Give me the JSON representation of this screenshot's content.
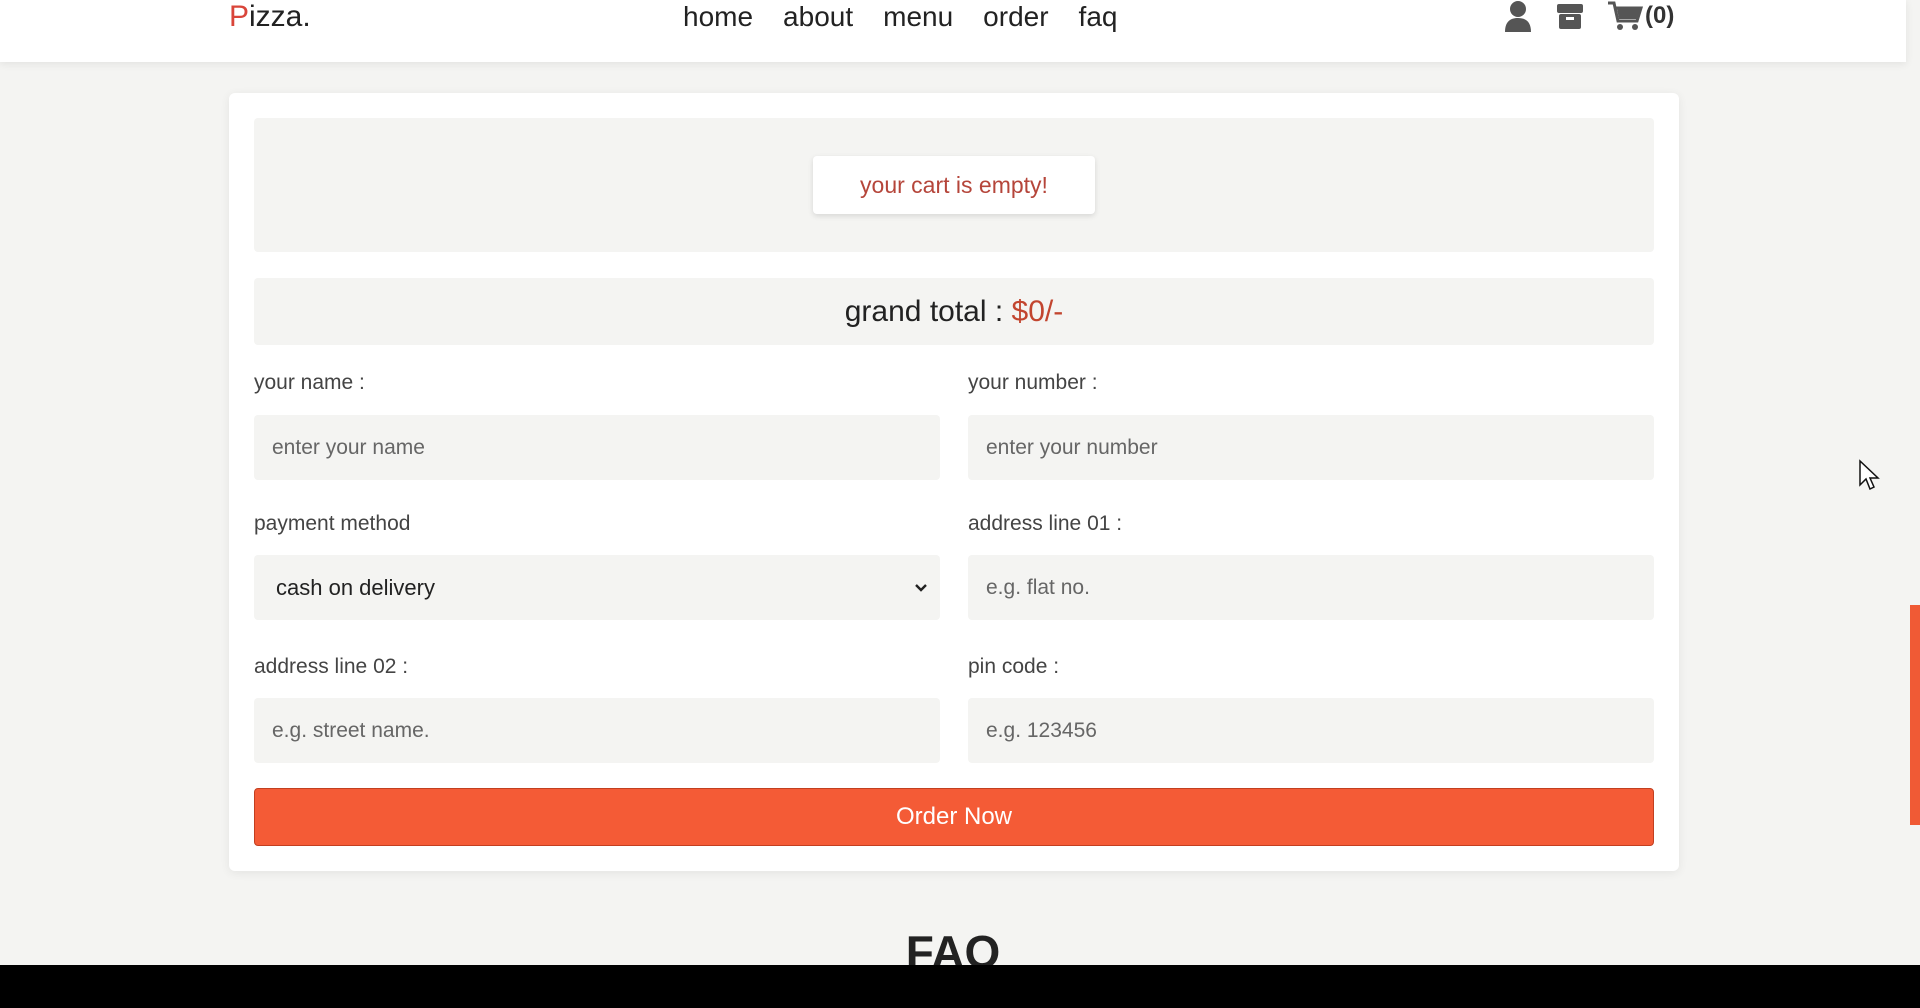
{
  "header": {
    "logo_first": "P",
    "logo_rest": "izza.",
    "nav": [
      "home",
      "about",
      "menu",
      "order",
      "faq"
    ],
    "icons": [
      "user-icon",
      "box-icon",
      "cart-icon"
    ],
    "cart_count": "(0)"
  },
  "cart": {
    "empty_message": "your cart is empty!",
    "total_label": "grand total : ",
    "total_value": "$0/-"
  },
  "form": {
    "name_label": "your name :",
    "name_placeholder": "enter your name",
    "number_label": "your number :",
    "number_placeholder": "enter your number",
    "payment_label": "payment method",
    "payment_selected": "cash on delivery",
    "address1_label": "address line 01 :",
    "address1_placeholder": "e.g. flat no.",
    "address2_label": "address line 02 :",
    "address2_placeholder": "e.g. street name.",
    "pin_label": "pin code :",
    "pin_placeholder": "e.g. 123456",
    "submit_label": "Order Now"
  },
  "faq_title": "FAQ",
  "colors": {
    "accent": "#f45b36",
    "price": "#c2452f",
    "background": "#f4f4f2"
  }
}
